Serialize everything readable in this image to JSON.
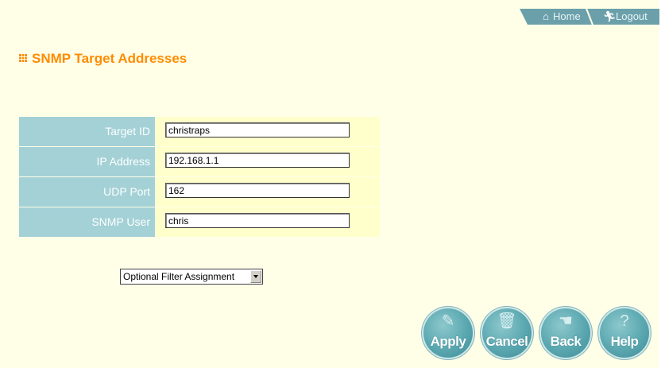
{
  "nav": {
    "home_label": "Home",
    "logout_label": "Logout"
  },
  "page": {
    "title": "SNMP Target Addresses"
  },
  "form": {
    "fields": [
      {
        "label": "Target ID",
        "value": "christraps"
      },
      {
        "label": "IP Address",
        "value": "192.168.1.1"
      },
      {
        "label": "UDP Port",
        "value": "162"
      },
      {
        "label": "SNMP User",
        "value": "chris"
      }
    ]
  },
  "filter_select": {
    "selected": "Optional Filter Assignment"
  },
  "buttons": {
    "apply": "Apply",
    "cancel": "Cancel",
    "back": "Back",
    "help": "Help"
  },
  "icons": {
    "home": "house-icon",
    "logout": "running-person-icon",
    "title": "grid-icon"
  },
  "colors": {
    "title": "#ff8c00",
    "label_bg": "#a3d1d6",
    "value_bg": "#ffffcc",
    "page_bg": "#ffffe8",
    "button": "#5aa7b0"
  }
}
